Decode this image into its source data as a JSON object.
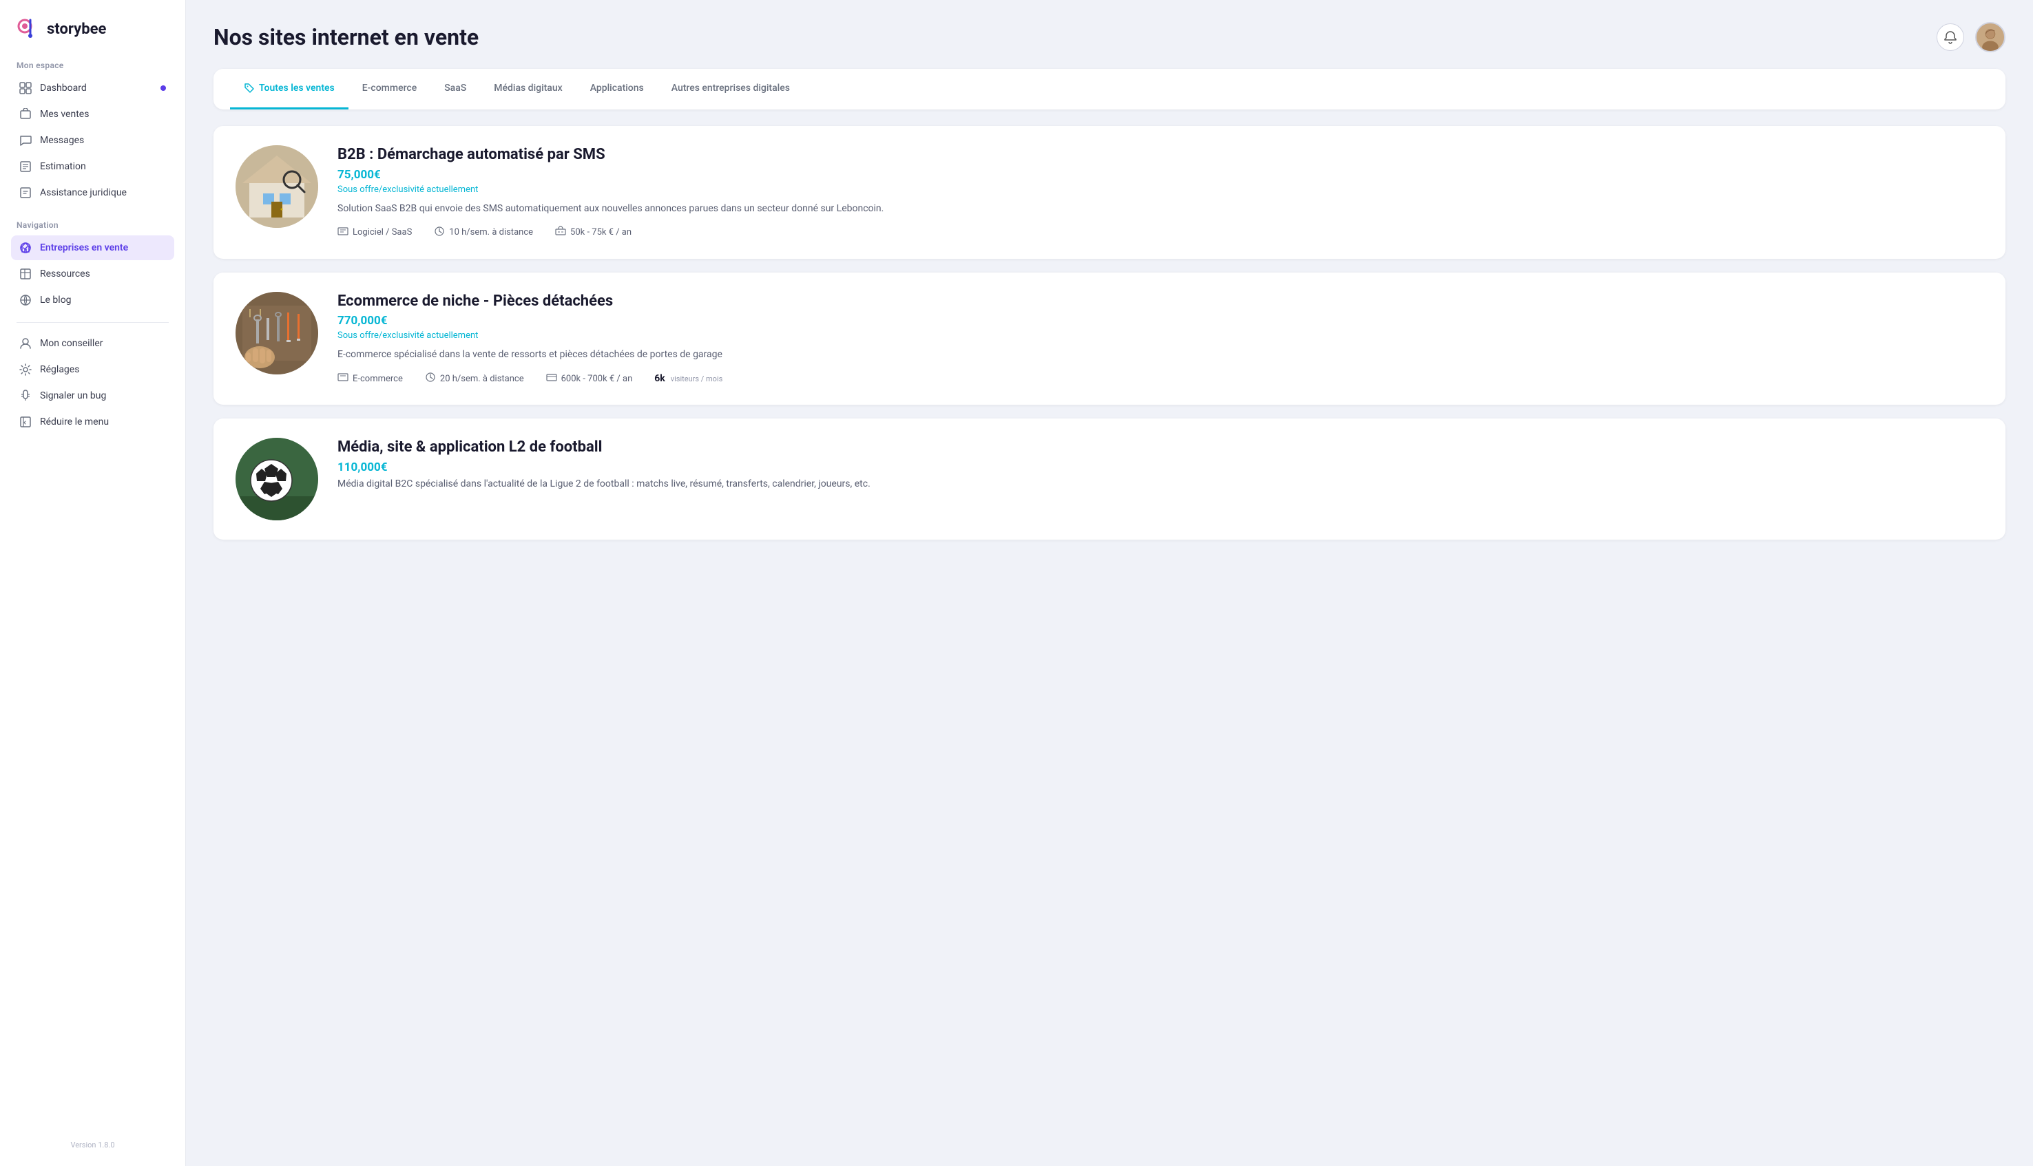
{
  "app": {
    "logo_text": "storybee",
    "version": "Version 1.8.0"
  },
  "sidebar": {
    "mon_espace_label": "Mon espace",
    "navigation_label": "Navigation",
    "items_mon_espace": [
      {
        "id": "dashboard",
        "label": "Dashboard",
        "has_dot": true,
        "icon": "grid"
      },
      {
        "id": "mes-ventes",
        "label": "Mes ventes",
        "has_dot": false,
        "icon": "bag"
      },
      {
        "id": "messages",
        "label": "Messages",
        "has_dot": false,
        "icon": "chat"
      },
      {
        "id": "estimation",
        "label": "Estimation",
        "has_dot": false,
        "icon": "table"
      },
      {
        "id": "assistance",
        "label": "Assistance juridique",
        "has_dot": false,
        "icon": "doc"
      }
    ],
    "items_navigation": [
      {
        "id": "entreprises",
        "label": "Entreprises en vente",
        "active": true,
        "icon": "tag"
      },
      {
        "id": "ressources",
        "label": "Ressources",
        "active": false,
        "icon": "window"
      },
      {
        "id": "blog",
        "label": "Le blog",
        "active": false,
        "icon": "globe"
      }
    ],
    "items_bottom": [
      {
        "id": "conseiller",
        "label": "Mon conseiller",
        "icon": "headset"
      },
      {
        "id": "reglages",
        "label": "Réglages",
        "icon": "gear"
      },
      {
        "id": "bug",
        "label": "Signaler un bug",
        "icon": "bug"
      },
      {
        "id": "reduire",
        "label": "Réduire le menu",
        "icon": "reduce"
      }
    ]
  },
  "page": {
    "title": "Nos sites internet en vente"
  },
  "tabs": [
    {
      "id": "toutes",
      "label": "Toutes les ventes",
      "active": true,
      "has_icon": true
    },
    {
      "id": "ecommerce",
      "label": "E-commerce",
      "active": false
    },
    {
      "id": "saas",
      "label": "SaaS",
      "active": false
    },
    {
      "id": "medias",
      "label": "Médias digitaux",
      "active": false
    },
    {
      "id": "applications",
      "label": "Applications",
      "active": false
    },
    {
      "id": "autres",
      "label": "Autres entreprises digitales",
      "active": false
    }
  ],
  "listings": [
    {
      "id": "listing-1",
      "title": "B2B : Démarchage automatisé par SMS",
      "price": "75,000€",
      "status": "Sous offre/exclusivité actuellement",
      "description": "Solution SaaS B2B qui envoie des SMS automatiquement aux nouvelles annonces parues dans un secteur donné sur Leboncoin.",
      "type": "Logiciel / SaaS",
      "hours": "10 h/sem. à distance",
      "revenue": "50k - 75k € / an",
      "visitors": null,
      "img_type": "house"
    },
    {
      "id": "listing-2",
      "title": "Ecommerce de niche - Pièces détachées",
      "price": "770,000€",
      "status": "Sous offre/exclusivité actuellement",
      "description": "E-commerce spécialisé dans la vente de ressorts et pièces détachées de portes de garage",
      "type": "E-commerce",
      "hours": "20 h/sem. à distance",
      "revenue": "600k - 700k € / an",
      "visitors": "6k visiteurs / mois",
      "img_type": "tools"
    },
    {
      "id": "listing-3",
      "title": "Média, site & application L2 de football",
      "price": "110,000€",
      "status": null,
      "description": "Média digital B2C spécialisé dans l'actualité de la Ligue 2 de football : matchs live, résumé, transferts, calendrier, joueurs, etc.",
      "type": null,
      "hours": null,
      "revenue": null,
      "visitors": null,
      "img_type": "football"
    }
  ]
}
